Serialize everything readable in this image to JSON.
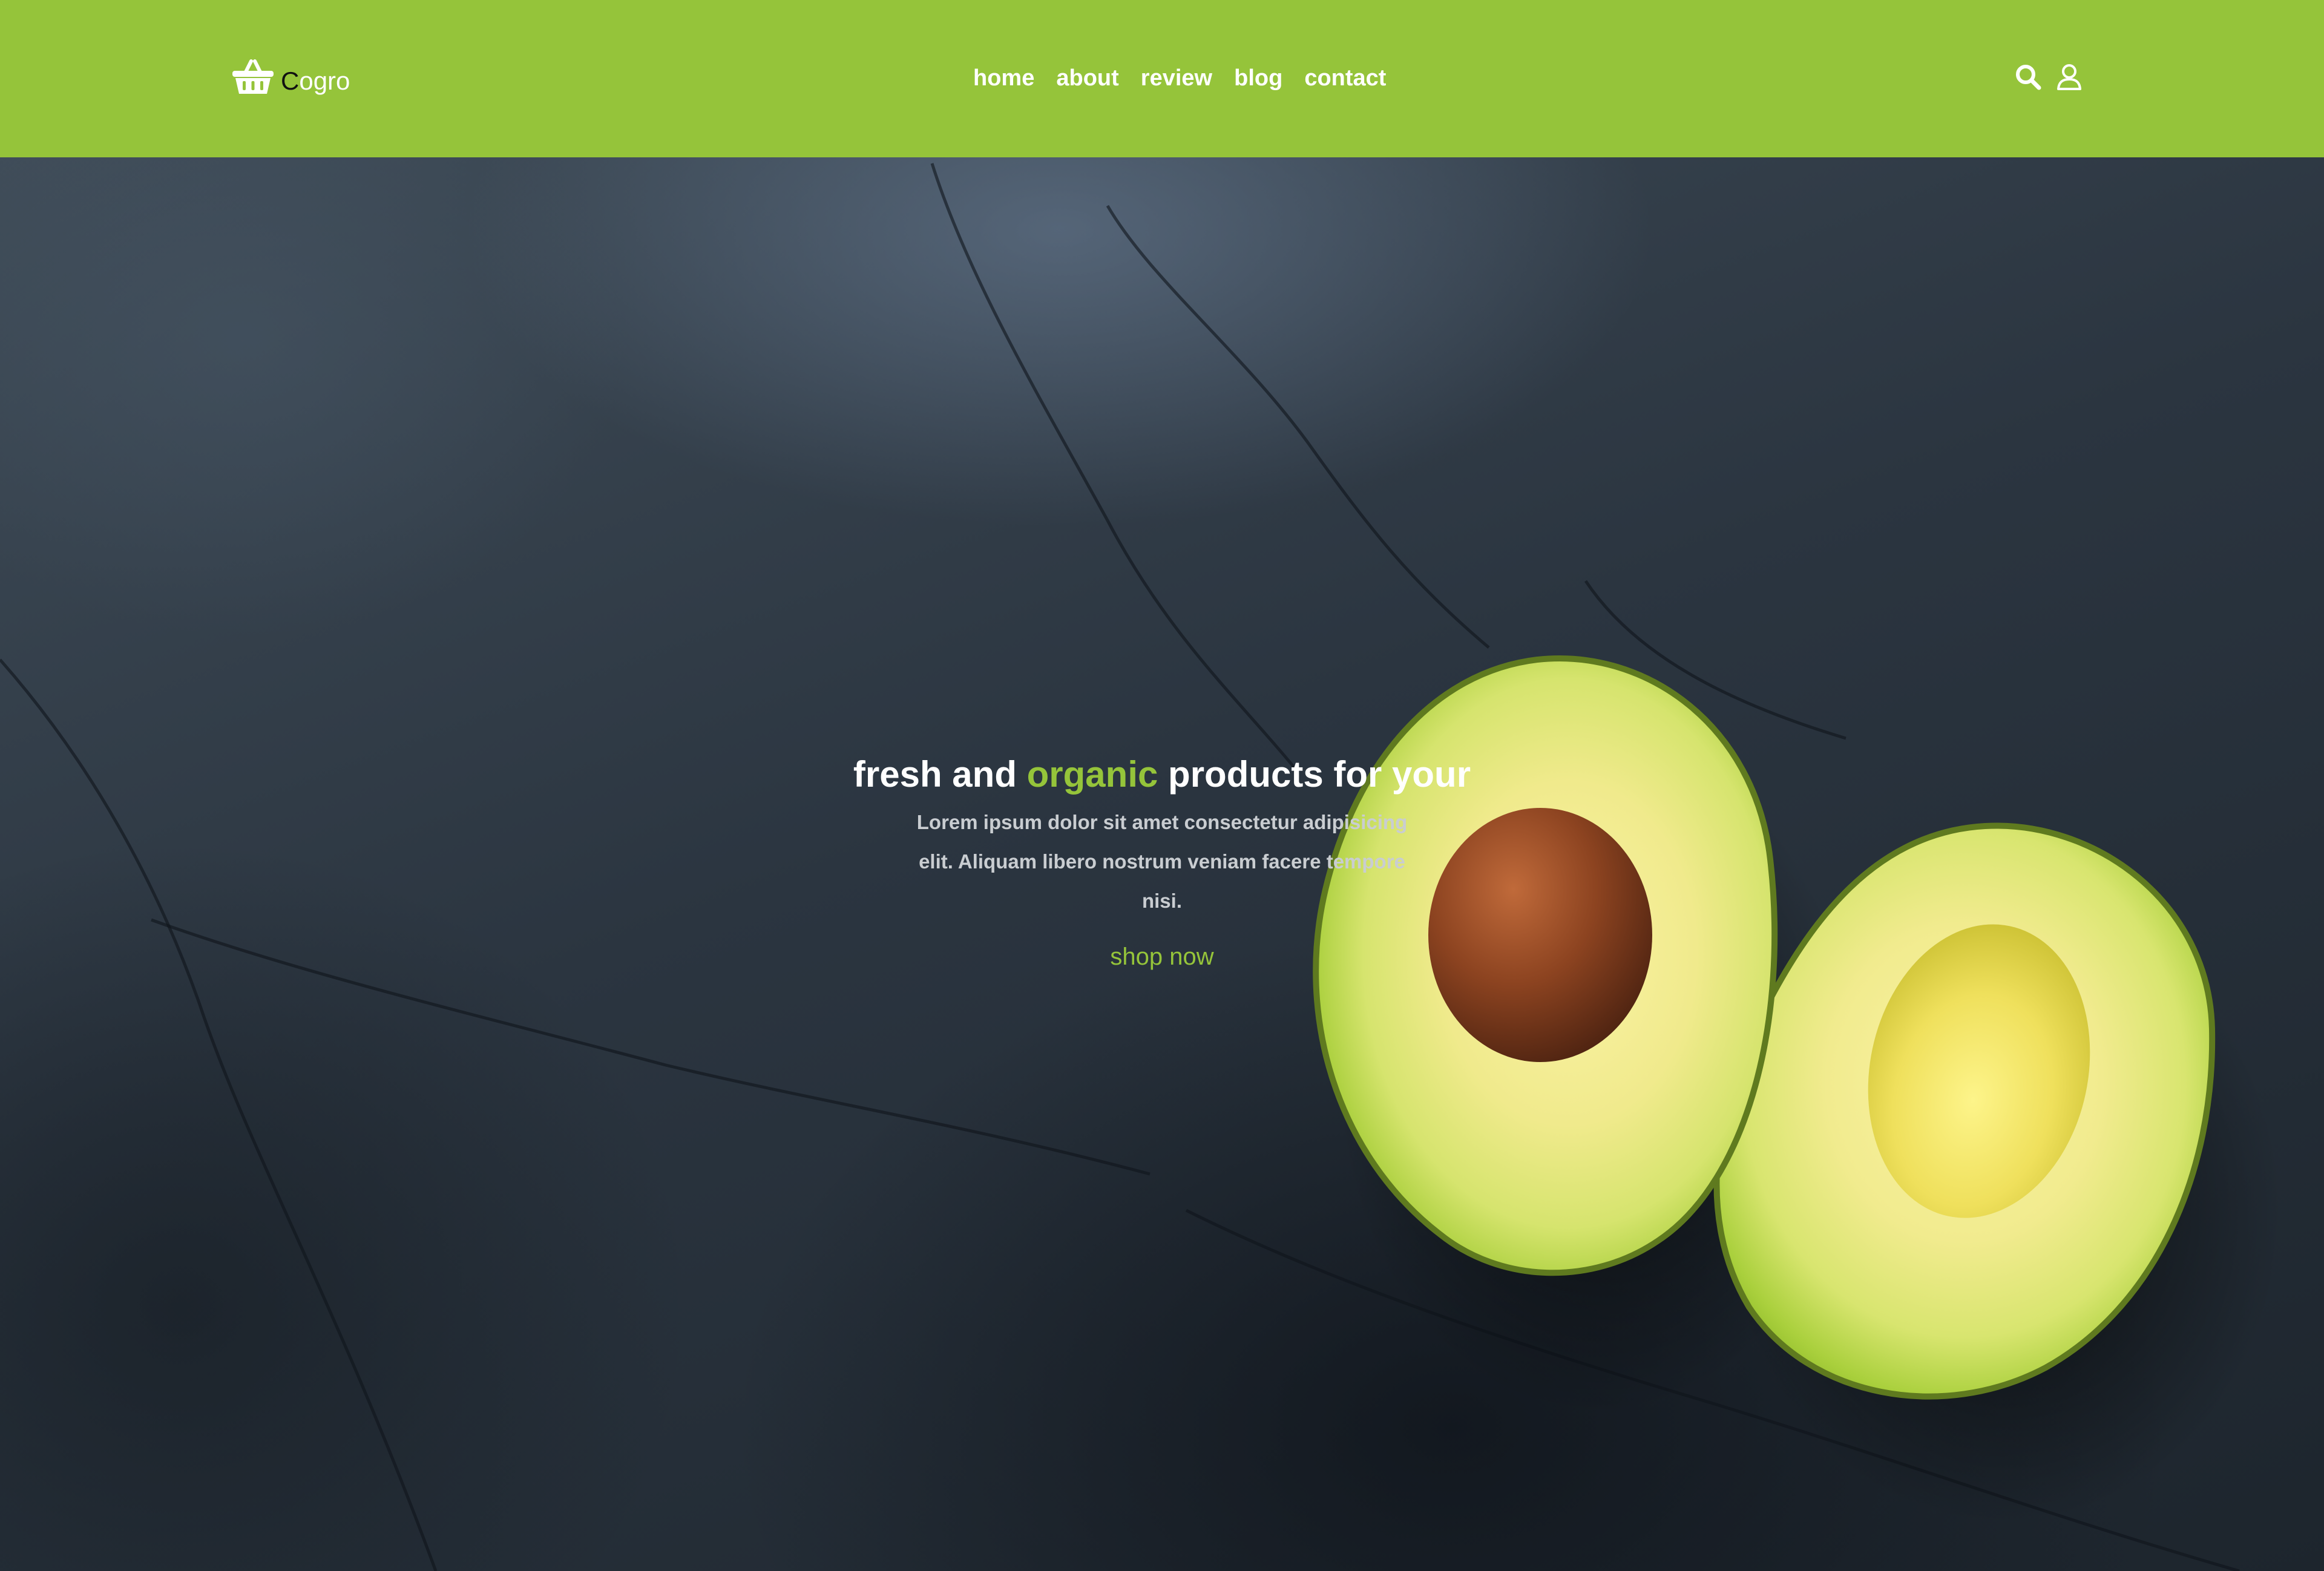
{
  "header": {
    "logo_icon": "shopping-basket-icon",
    "logo_first_letter": "C",
    "logo_rest": "ogro",
    "nav": [
      {
        "label": "home"
      },
      {
        "label": "about"
      },
      {
        "label": "review"
      },
      {
        "label": "blog"
      },
      {
        "label": "contact"
      }
    ],
    "tools": [
      "search-icon",
      "user-icon"
    ],
    "background_color": "#95c43a"
  },
  "hero": {
    "title_before": "fresh and ",
    "title_accent": "organic",
    "title_after": " products for your",
    "description": "Lorem ipsum dolor sit amet consectetur adipisicing elit. Aliquam libero nostrum veniam facere tempore nisi.",
    "button_label": "shop now",
    "accent_color": "#95c43a",
    "background_image": "avocado halves on dark slate"
  }
}
